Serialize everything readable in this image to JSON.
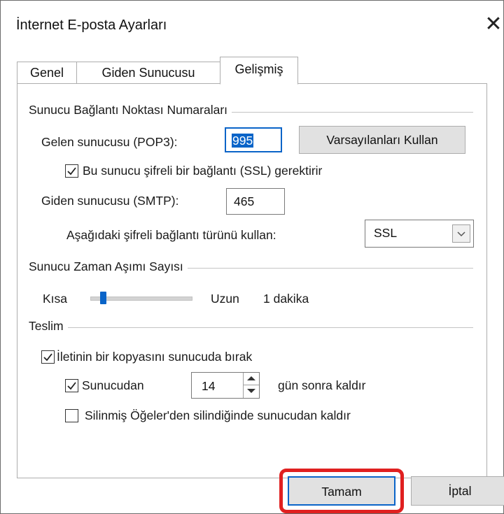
{
  "window": {
    "title": "İnternet E-posta Ayarları",
    "close_glyph": "✕"
  },
  "tabs": [
    {
      "label": "Genel",
      "active": false
    },
    {
      "label": "Giden Sunucusu",
      "active": false
    },
    {
      "label": "Gelişmiş",
      "active": true
    }
  ],
  "ports": {
    "group_label": "Sunucu Bağlantı Noktası Numaraları",
    "incoming_label": "Gelen sunucusu (POP3):",
    "incoming_value": "995",
    "defaults_button": "Varsayılanları Kullan",
    "ssl_checkbox_label": "Bu sunucu şifreli bir bağlantı (SSL) gerektirir",
    "ssl_checked": true,
    "outgoing_label": "Giden sunucusu (SMTP):",
    "outgoing_value": "465",
    "encryption_label": "Aşağıdaki şifreli bağlantı türünü kullan:",
    "encryption_value": "SSL"
  },
  "timeout": {
    "group_label": "Sunucu Zaman Aşımı Sayısı",
    "short_label": "Kısa",
    "long_label": "Uzun",
    "value_label": "1 dakika",
    "level_fraction": 0.1
  },
  "delivery": {
    "group_label": "Teslim",
    "leave_copy_label": "İletinin bir kopyasını sunucuda bırak",
    "leave_copy_checked": true,
    "remove_after_label": "Sunucudan",
    "remove_after_checked": true,
    "days_value": "14",
    "days_suffix": "gün sonra kaldır",
    "remove_deleted_label": "Silinmiş Öğeler'den silindiğinde sunucudan kaldır",
    "remove_deleted_checked": false
  },
  "footer": {
    "ok_label": "Tamam",
    "cancel_label": "İptal"
  },
  "colors": {
    "accent": "#0a64c8",
    "highlight": "#e02020"
  }
}
